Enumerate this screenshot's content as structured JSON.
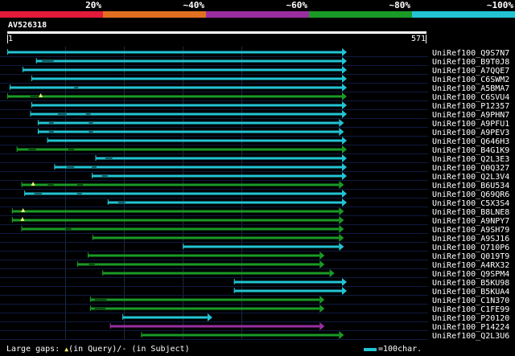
{
  "legend": [
    {
      "label": "20%",
      "color": "#e31a3a"
    },
    {
      "label": "~40%",
      "color": "#e07020"
    },
    {
      "label": "~60%",
      "color": "#9a2ea0"
    },
    {
      "label": "~80%",
      "color": "#1a9a26"
    },
    {
      "label": "~100%",
      "color": "#22c4d4"
    }
  ],
  "query": {
    "id": "AV526318",
    "start": "1",
    "end": "571",
    "length": 571
  },
  "hits": [
    {
      "name": "UniRef100_Q9S7N7",
      "color": "cyan",
      "start": 1,
      "end": 571,
      "gaps": [],
      "mark": false
    },
    {
      "name": "UniRef100_B9T0J8",
      "color": "cyan",
      "start": 50,
      "end": 571,
      "gaps": [
        [
          60,
          80
        ]
      ],
      "mark": false
    },
    {
      "name": "UniRef100_A7QQE7",
      "color": "cyan",
      "start": 27,
      "end": 571,
      "gaps": [],
      "mark": false
    },
    {
      "name": "UniRef100_C6SWM2",
      "color": "cyan",
      "start": 42,
      "end": 571,
      "gaps": [],
      "mark": false
    },
    {
      "name": "UniRef100_A5BMA7",
      "color": "cyan",
      "start": 5,
      "end": 571,
      "gaps": [
        [
          115,
          122
        ]
      ],
      "mark": false
    },
    {
      "name": "UniRef100_C6SVU4",
      "color": "green",
      "start": 1,
      "end": 571,
      "gaps": [
        [
          40,
          60
        ]
      ],
      "mark": true,
      "mark_at": 58
    },
    {
      "name": "UniRef100_P12357",
      "color": "cyan",
      "start": 42,
      "end": 571,
      "gaps": [],
      "mark": false
    },
    {
      "name": "UniRef100_A9PHN7",
      "color": "cyan",
      "start": 40,
      "end": 571,
      "gaps": [
        [
          87,
          102
        ],
        [
          135,
          143
        ]
      ],
      "mark": false
    },
    {
      "name": "UniRef100_A9PFU1",
      "color": "cyan",
      "start": 53,
      "end": 566,
      "gaps": [
        [
          72,
          80
        ],
        [
          140,
          147
        ]
      ],
      "mark": false
    },
    {
      "name": "UniRef100_A9PEV3",
      "color": "cyan",
      "start": 53,
      "end": 566,
      "gaps": [
        [
          72,
          80
        ],
        [
          140,
          147
        ]
      ],
      "mark": false
    },
    {
      "name": "UniRef100_Q646H3",
      "color": "cyan",
      "start": 69,
      "end": 571,
      "gaps": [],
      "mark": false
    },
    {
      "name": "UniRef100_B4G1K9",
      "color": "green",
      "start": 17,
      "end": 571,
      "gaps": [
        [
          37,
          50
        ],
        [
          105,
          115
        ]
      ],
      "mark": false
    },
    {
      "name": "UniRef100_Q2L3E3",
      "color": "cyan",
      "start": 151,
      "end": 571,
      "gaps": [
        [
          168,
          180
        ]
      ],
      "mark": false
    },
    {
      "name": "UniRef100_Q0Q327",
      "color": "cyan",
      "start": 81,
      "end": 571,
      "gaps": [
        [
          102,
          115
        ],
        [
          145,
          153
        ]
      ],
      "mark": false
    },
    {
      "name": "UniRef100_Q2L3V4",
      "color": "cyan",
      "start": 145,
      "end": 571,
      "gaps": [
        [
          162,
          172
        ]
      ],
      "mark": false
    },
    {
      "name": "UniRef100_B6U534",
      "color": "green",
      "start": 25,
      "end": 566,
      "gaps": [
        [
          70,
          80
        ],
        [
          120,
          130
        ]
      ],
      "mark": true,
      "mark_at": 45
    },
    {
      "name": "UniRef100_Q69QR6",
      "color": "cyan",
      "start": 30,
      "end": 571,
      "gaps": [
        [
          47,
          60
        ],
        [
          120,
          128
        ]
      ],
      "mark": false
    },
    {
      "name": "UniRef100_C5X3S4",
      "color": "cyan",
      "start": 172,
      "end": 571,
      "gaps": [
        [
          190,
          202
        ]
      ],
      "mark": false
    },
    {
      "name": "UniRef100_B8LNE8",
      "color": "green",
      "start": 9,
      "end": 566,
      "gaps": [],
      "mark": true,
      "mark_at": 28
    },
    {
      "name": "UniRef100_A9NPY7",
      "color": "green",
      "start": 9,
      "end": 566,
      "gaps": [],
      "mark": true,
      "mark_at": 27
    },
    {
      "name": "UniRef100_A9SH79",
      "color": "green",
      "start": 25,
      "end": 566,
      "gaps": [
        [
          100,
          110
        ]
      ],
      "mark": false
    },
    {
      "name": "UniRef100_A9SJ16",
      "color": "green",
      "start": 146,
      "end": 566,
      "gaps": [],
      "mark": false
    },
    {
      "name": "UniRef100_Q710P6",
      "color": "cyan",
      "start": 300,
      "end": 566,
      "gaps": [],
      "mark": false
    },
    {
      "name": "UniRef100_Q019T9",
      "color": "green",
      "start": 138,
      "end": 533,
      "gaps": [],
      "mark": false
    },
    {
      "name": "UniRef100_A4RX32",
      "color": "green",
      "start": 120,
      "end": 533,
      "gaps": [
        [
          140,
          150
        ]
      ],
      "mark": false
    },
    {
      "name": "UniRef100_Q9SPM4",
      "color": "green",
      "start": 163,
      "end": 550,
      "gaps": [],
      "mark": false
    },
    {
      "name": "UniRef100_B5KU98",
      "color": "cyan",
      "start": 387,
      "end": 571,
      "gaps": [],
      "mark": false
    },
    {
      "name": "UniRef100_B5KUA4",
      "color": "cyan",
      "start": 387,
      "end": 571,
      "gaps": [],
      "mark": false
    },
    {
      "name": "UniRef100_C1N370",
      "color": "green",
      "start": 142,
      "end": 533,
      "gaps": [
        [
          150,
          170
        ]
      ],
      "mark": false
    },
    {
      "name": "UniRef100_C1FE99",
      "color": "green",
      "start": 142,
      "end": 533,
      "gaps": [
        [
          150,
          168
        ]
      ],
      "mark": false
    },
    {
      "name": "UniRef100_P20120",
      "color": "cyan",
      "start": 197,
      "end": 342,
      "gaps": [],
      "mark": false
    },
    {
      "name": "UniRef100_P14224",
      "color": "purple",
      "start": 176,
      "end": 533,
      "gaps": [],
      "mark": false
    },
    {
      "name": "UniRef100_Q2L3U6",
      "color": "green",
      "start": 229,
      "end": 566,
      "gaps": [],
      "mark": false
    }
  ],
  "colors": {
    "cyan": "#22c4d4",
    "green": "#1a9a26",
    "purple": "#9a2ea0",
    "mark": "#f0f070"
  },
  "footer": {
    "gaps_prefix": "Large gaps: ",
    "gaps_query": "(in Query)/",
    "gaps_subject": "- (in Subject)",
    "scale_label": "=100char."
  }
}
